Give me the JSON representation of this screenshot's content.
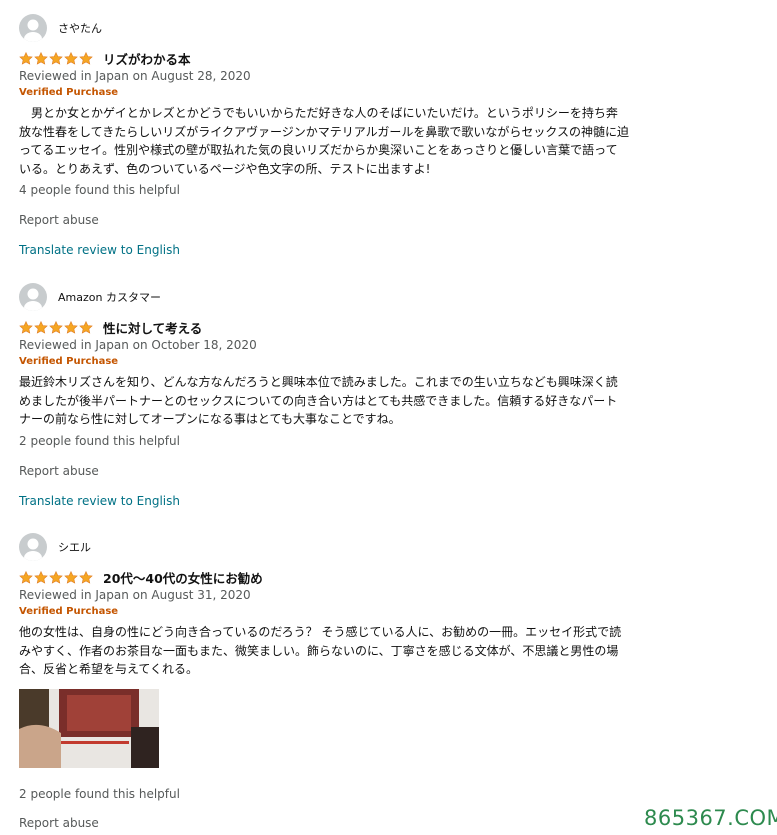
{
  "accent_colors": {
    "star": "#f5a623",
    "verified": "#c45500",
    "link": "#007185",
    "meta": "#565959"
  },
  "reviews": [
    {
      "username": "さやたん",
      "rating": 5,
      "title": "リズがわかる本",
      "date_line": "Reviewed in Japan on August 28, 2020",
      "verified": "Verified Purchase",
      "body": "　男とか女とかゲイとかレズとかどうでもいいからただ好きな人のそばにいたいだけ。というポリシーを持ち奔放な性春をしてきたらしいリズがライクアヴァージンかマテリアルガールを鼻歌で歌いながらセックスの神髄に迫ってるエッセイ。性別や様式の壁が取払れた気の良いリズだからか奥深いことをあっさりと優しい言葉で語っている。とりあえず、色のついているページや色文字の所、テストに出ますよ!",
      "helpful": "4 people found this helpful",
      "report": "Report abuse",
      "translate": "Translate review to English"
    },
    {
      "username": "Amazon カスタマー",
      "rating": 5,
      "title": "性に対して考える",
      "date_line": "Reviewed in Japan on October 18, 2020",
      "verified": "Verified Purchase",
      "body": "最近鈴木リズさんを知り、どんな方なんだろうと興味本位で読みました。これまでの生い立ちなども興味深く読めましたが後半パートナーとのセックスについての向き合い方はとても共感できました。信頼する好きなパートナーの前なら性に対してオープンになる事はとても大事なことですね。",
      "helpful": "2 people found this helpful",
      "report": "Report abuse",
      "translate": "Translate review to English"
    },
    {
      "username": "シエル",
      "rating": 5,
      "title": "20代～40代の女性にお勧め",
      "date_line": "Reviewed in Japan on August 31, 2020",
      "verified": "Verified Purchase",
      "body": "他の女性は、自身の性にどう向き合っているのだろう？ そう感じている人に、お勧めの一冊。エッセイ形式で読みやすく、作者のお茶目な一面もまた、微笑ましい。飾らないのに、丁寧さを感じる文体が、不思議と男性の場合、反省と希望を与えてくれる。",
      "helpful": "2 people found this helpful",
      "report": "Report abuse"
    }
  ],
  "watermark": "865367.COM"
}
